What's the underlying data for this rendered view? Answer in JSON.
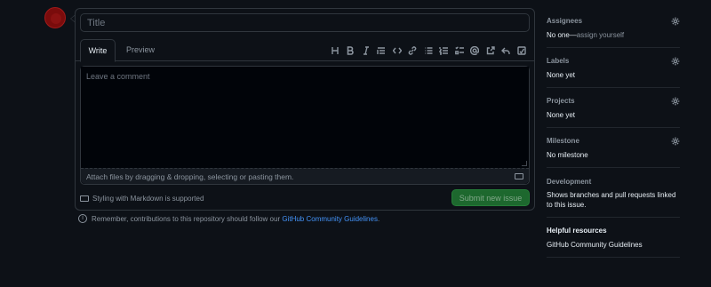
{
  "composer": {
    "title_placeholder": "Title",
    "tabs": [
      {
        "label": "Write",
        "active": true
      },
      {
        "label": "Preview",
        "active": false
      }
    ],
    "toolbar_icons": [
      "heading-icon",
      "bold-icon",
      "italic-icon",
      "quote-icon",
      "code-icon",
      "link-icon",
      "bulleted-list-icon",
      "numbered-list-icon",
      "task-list-icon",
      "mention-icon",
      "cross-reference-icon",
      "undo-reply-icon",
      "fullscreen-icon"
    ],
    "comment_placeholder": "Leave a comment",
    "attach_text": "Attach files by dragging & dropping, selecting or pasting them.",
    "markdown_note": "Styling with Markdown is supported",
    "submit_label": "Submit new issue"
  },
  "reminder": {
    "text": "Remember, contributions to this repository should follow our",
    "link": "GitHub Community Guidelines",
    "suffix": "."
  },
  "sidebar": {
    "assignees": {
      "heading": "Assignees",
      "none": "No one—",
      "action": "assign yourself"
    },
    "labels": {
      "heading": "Labels",
      "value": "None yet"
    },
    "projects": {
      "heading": "Projects",
      "value": "None yet"
    },
    "milestone": {
      "heading": "Milestone",
      "value": "No milestone"
    },
    "development": {
      "heading": "Development",
      "value": "Shows branches and pull requests linked to this issue."
    },
    "helpful": {
      "heading": "Helpful resources",
      "link": "GitHub Community Guidelines"
    }
  },
  "colors": {
    "background": "#0d1117",
    "border": "#30363d",
    "accent_link": "#4493f8",
    "submit_green": "#238636"
  }
}
